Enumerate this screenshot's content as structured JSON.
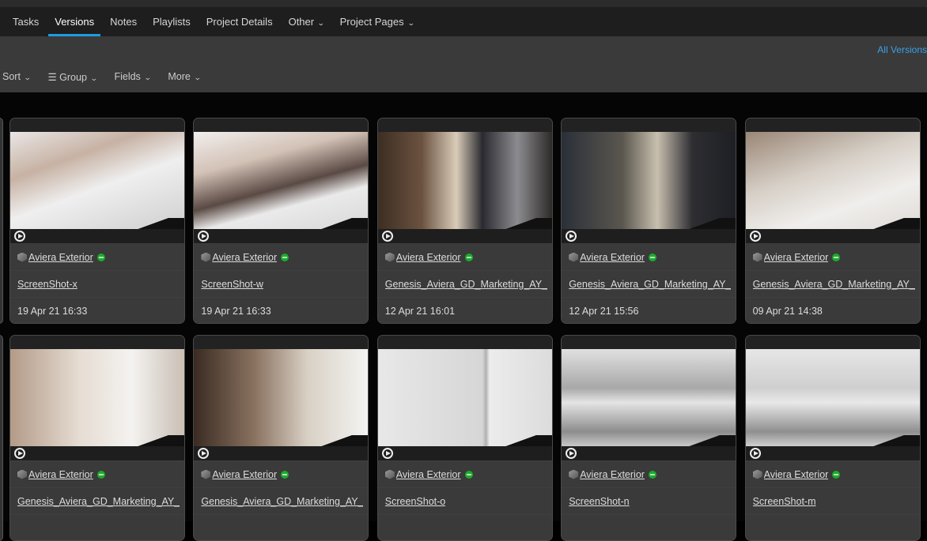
{
  "nav": {
    "tabs": [
      {
        "label": "Tasks"
      },
      {
        "label": "Versions",
        "active": true
      },
      {
        "label": "Notes"
      },
      {
        "label": "Playlists"
      },
      {
        "label": "Project Details"
      },
      {
        "label": "Other",
        "dropdown": true
      },
      {
        "label": "Project Pages",
        "dropdown": true
      }
    ]
  },
  "toolbar": {
    "all_versions": "All Versions",
    "sort": "Sort",
    "group": "Group",
    "fields": "Fields",
    "more": "More"
  },
  "colors": {
    "accent": "#1f9be0",
    "status": "#1eaa2e"
  },
  "cards": [
    {
      "entity": "Aviera Exterior",
      "name": "ScreenShot-x",
      "date": "19 Apr 21 16:33",
      "thumb": "linear-gradient(160deg,#e9e6e4 0%,#c7b2a4 30%,#efefef 55%,#cfcfcf 100%)"
    },
    {
      "entity": "Aviera Exterior",
      "name": "ScreenShot-w",
      "date": "19 Apr 21 16:33",
      "thumb": "linear-gradient(165deg,#f1efee 0%,#d3c2b6 30%,#5a4a44 55%,#eaeaea 70%,#d8d8d8 100%)"
    },
    {
      "entity": "Aviera Exterior",
      "name": "Genesis_Aviera_GD_Marketing_AY_C",
      "date": "12 Apr 21 16:01",
      "thumb": "linear-gradient(90deg,#3c2e22 0%,#6b5240 25%,#d9ccb8 45%,#2a2a30 60%,#8c8c90 80%,#2d2a28 100%)"
    },
    {
      "entity": "Aviera Exterior",
      "name": "Genesis_Aviera_GD_Marketing_AY_C",
      "date": "12 Apr 21 15:56",
      "thumb": "linear-gradient(90deg,#2a2f38 0%,#5b574f 35%,#c8bfae 55%,#2e2e32 75%,#1d1f24 100%)"
    },
    {
      "entity": "Aviera Exterior",
      "name": "Genesis_Aviera_GD_Marketing_AY_C",
      "date": "09 Apr 21 14:38",
      "thumb": "linear-gradient(160deg,#9a8676 0%,#d6cfc6 40%,#f0eeec 70%,#dedad6 100%)"
    },
    {
      "entity": "Aviera Exterior",
      "name": "Genesis_Aviera_GD_Marketing_AY_C",
      "date": "",
      "thumb": "linear-gradient(90deg,#b39a88 0%,#e6ddd3 40%,#f4f2f0 70%,#c9bfb4 100%)"
    },
    {
      "entity": "Aviera Exterior",
      "name": "Genesis_Aviera_GD_Marketing_AY_C",
      "date": "",
      "thumb": "linear-gradient(90deg,#3a2b22 0%,#8a7260 35%,#d8d0c4 65%,#f4f4f2 100%)"
    },
    {
      "entity": "Aviera Exterior",
      "name": "ScreenShot-o",
      "date": "",
      "thumb": "linear-gradient(90deg,#e8e8e8 0%,#d6d6d6 60%,#b0b0b0 62%,#ececec 64%,#dcdcdc 100%)"
    },
    {
      "entity": "Aviera Exterior",
      "name": "ScreenShot-n",
      "date": "",
      "thumb": "linear-gradient(180deg,#e0e0e0 0%,#a8a8a8 40%,#e4e4e4 55%,#8d8d8d 85%,#c8c8c8 100%)"
    },
    {
      "entity": "Aviera Exterior",
      "name": "ScreenShot-m",
      "date": "",
      "thumb": "linear-gradient(180deg,#e6e6e6 0%,#cfcfcf 40%,#e8e8e8 55%,#8f8f8f 85%,#cfcfcf 100%)"
    }
  ]
}
